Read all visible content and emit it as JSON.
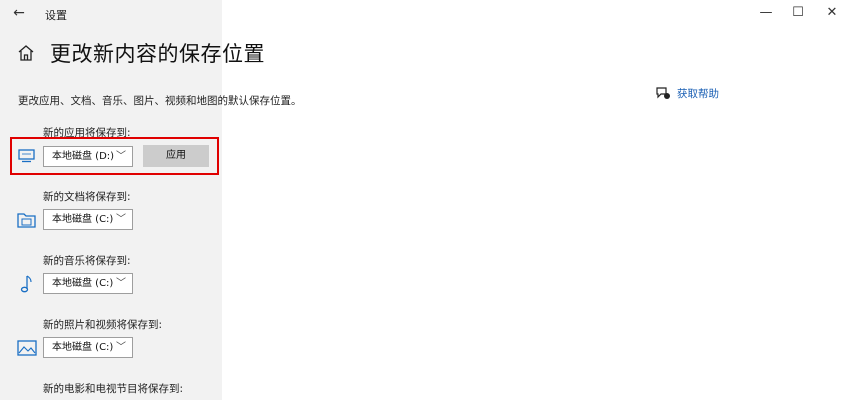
{
  "window": {
    "title": "设置",
    "back_glyph": "←",
    "minimize_glyph": "—",
    "maximize_glyph": "☐",
    "close_glyph": "✕"
  },
  "page": {
    "title": "更改新内容的保存位置",
    "description": "更改应用、文档、音乐、图片、视频和地图的默认保存位置。"
  },
  "help": {
    "label": "获取帮助",
    "icon": "chat-help-icon"
  },
  "sections": [
    {
      "label": "新的应用将保存到:",
      "value": "本地磁盘 (D:)",
      "icon": "monitor-icon",
      "apply_label": "应用"
    },
    {
      "label": "新的文档将保存到:",
      "value": "本地磁盘 (C:)",
      "icon": "folder-document-icon"
    },
    {
      "label": "新的音乐将保存到:",
      "value": "本地磁盘 (C:)",
      "icon": "music-note-icon"
    },
    {
      "label": "新的照片和视频将保存到:",
      "value": "本地磁盘 (C:)",
      "icon": "picture-icon"
    },
    {
      "label": "新的电影和电视节目将保存到:"
    }
  ],
  "colors": {
    "highlight": "#e00000",
    "link": "#1a5fb4",
    "left_panel": "#f2f2f2"
  }
}
